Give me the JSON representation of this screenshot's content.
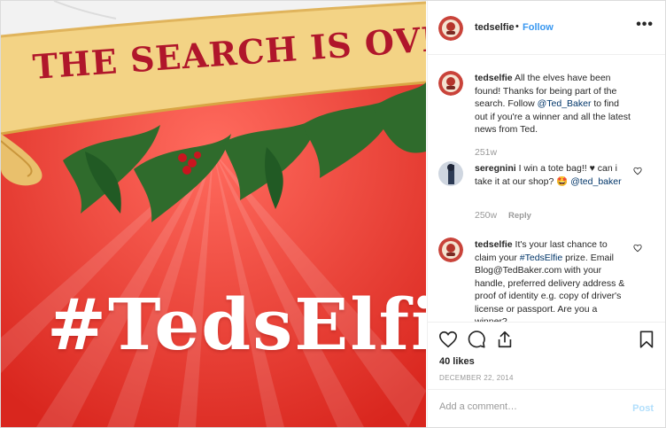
{
  "media": {
    "banner_text": "THE SEARCH IS OVE",
    "hashtag_text": "#TedsElfie"
  },
  "header": {
    "username": "tedselfie",
    "separator": "•",
    "follow_label": "Follow",
    "more_icon": "more-horizontal-icon"
  },
  "comments": [
    {
      "username": "tedselfie",
      "text_before": "All the elves have been found! Thanks for being part of the search. Follow ",
      "mention": "@Ted_Baker",
      "text_after": " to find out if you're a winner and all the latest news from Ted.",
      "age": "251w"
    },
    {
      "username": "seregnini",
      "text_before": "I win a tote bag!! ♥ can i take it at our shop? 🤩 ",
      "mention": "@ted_baker",
      "text_after": "",
      "age": "250w",
      "reply_label": "Reply"
    },
    {
      "username": "tedselfie",
      "text_before": "It's your last chance to claim your ",
      "mention": "#TedsElfie",
      "text_after": " prize. Email Blog@TedBaker.com with your handle, preferred delivery address & proof of identity e.g. copy of driver's license or passport. Are you a winner?",
      "age": ""
    }
  ],
  "actions": {
    "like_icon": "heart-icon",
    "comment_icon": "comment-icon",
    "share_icon": "share-icon",
    "save_icon": "bookmark-icon",
    "likes_text": "40 likes",
    "date_text": "DECEMBER 22, 2014"
  },
  "add_comment": {
    "placeholder": "Add a comment…",
    "post_label": "Post"
  },
  "colors": {
    "link_blue": "#3897f0",
    "post_disabled": "#b2dffc",
    "muted": "#999999",
    "background_red": "#e23b31"
  }
}
